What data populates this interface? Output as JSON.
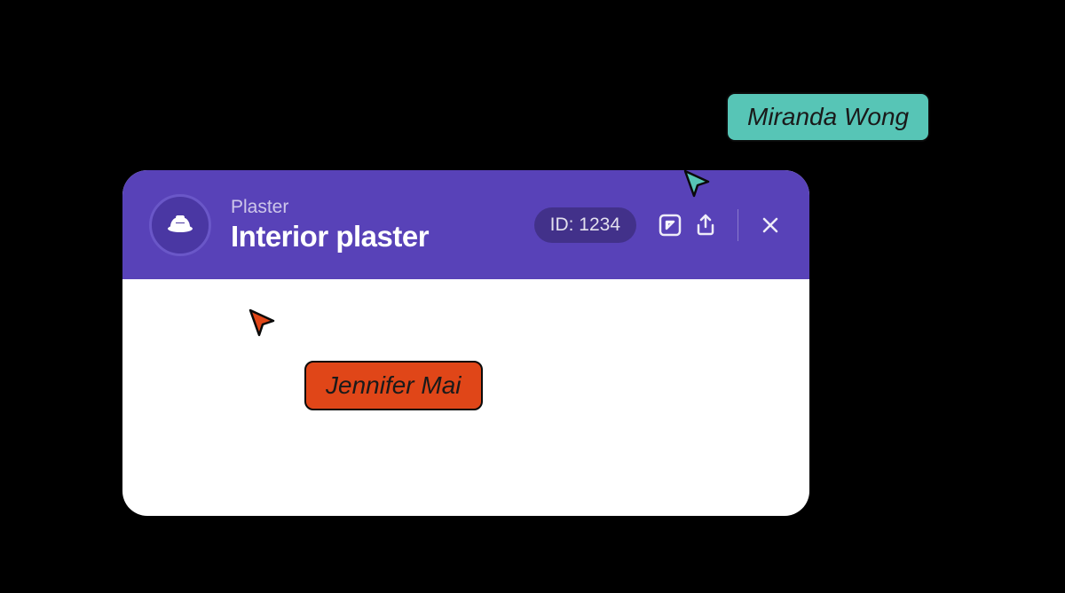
{
  "header": {
    "subtitle": "Plaster",
    "title": "Interior plaster",
    "id_label": "ID: 1234"
  },
  "cursors": {
    "user1": "Miranda Wong",
    "user2": "Jennifer Mai"
  }
}
